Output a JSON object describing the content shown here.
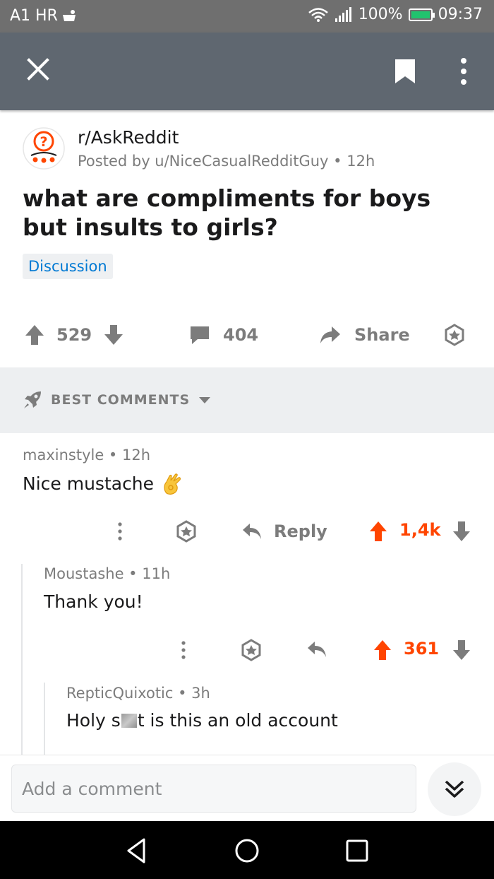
{
  "status_bar": {
    "carrier": "A1 HR",
    "battery": "100%",
    "time": "09:37"
  },
  "toolbar": {
    "icons": [
      "close-icon",
      "bookmark-icon",
      "more-vertical-icon"
    ]
  },
  "post": {
    "subreddit": "r/AskReddit",
    "posted_by": "Posted by u/NiceCasualRedditGuy • 12h",
    "title": "what are compliments for boys but insults to girls?",
    "flair": "Discussion",
    "score": "529",
    "comments": "404",
    "share_label": "Share"
  },
  "sort": {
    "label": "BEST COMMENTS"
  },
  "comments": [
    {
      "meta": "maxinstyle • 12h",
      "body": "Nice mustache",
      "reply_label": "Reply",
      "score": "1,4k"
    },
    {
      "meta": "Moustashe • 11h",
      "body": "Thank you!",
      "score": "361"
    },
    {
      "meta": "RepticQuixotic • 3h",
      "body_prefix": "Holy s",
      "body_suffix": "t is this an old account"
    }
  ],
  "composer": {
    "placeholder": "Add a comment"
  },
  "colors": {
    "upvote": "#ff4500",
    "link_blue": "#0079d3",
    "toolbar": "#5f6770"
  }
}
